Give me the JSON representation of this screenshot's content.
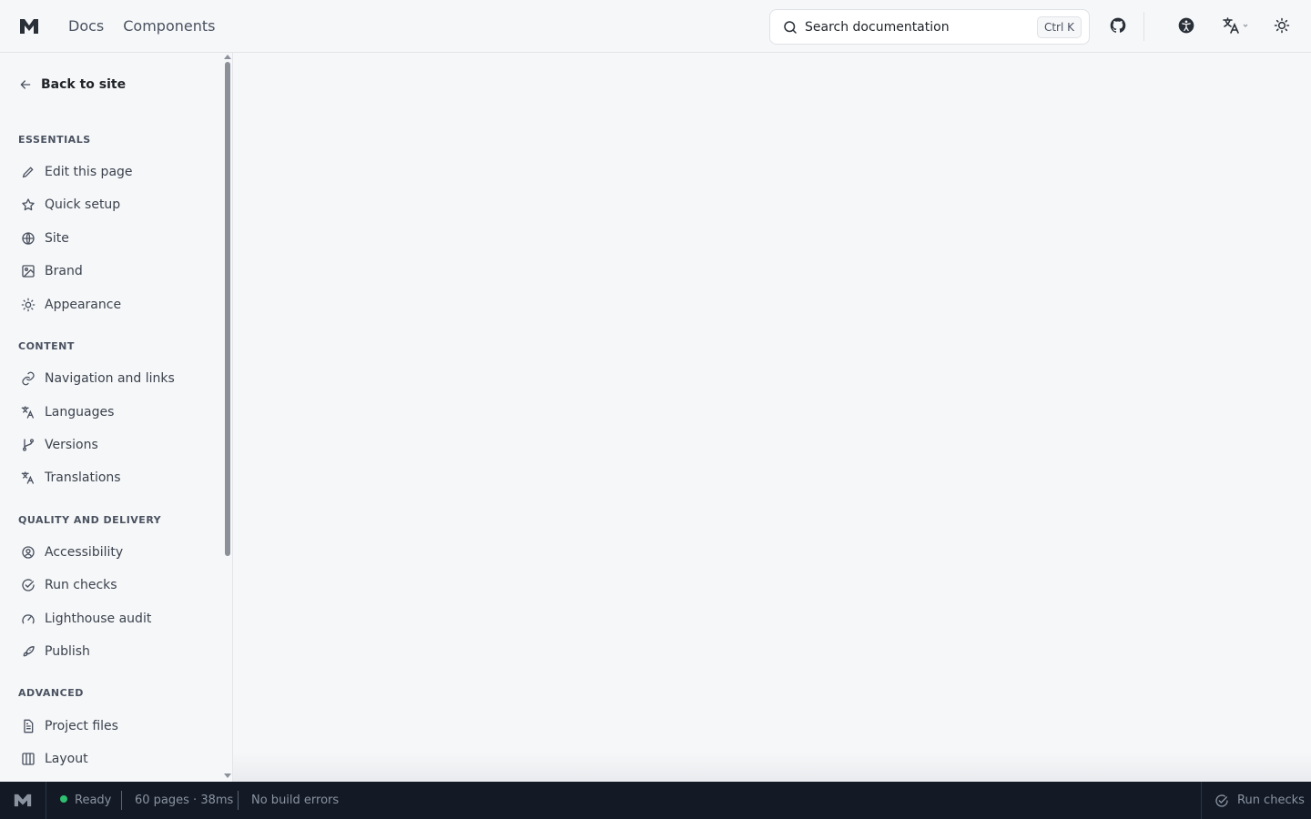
{
  "header": {
    "logo_icon": "brand-m-logo",
    "nav": [
      {
        "label": "Docs"
      },
      {
        "label": "Components"
      }
    ],
    "search": {
      "placeholder": "Search documentation",
      "shortcut": "Ctrl K"
    },
    "icons": [
      "github-icon",
      "accessibility-icon",
      "translate-icon",
      "theme-sun-icon"
    ]
  },
  "sidebar": {
    "back_label": "Back to site",
    "sections": [
      {
        "title": "ESSENTIALS",
        "items": [
          {
            "label": "Edit this page",
            "icon": "pencil-icon"
          },
          {
            "label": "Quick setup",
            "icon": "star-icon"
          },
          {
            "label": "Site",
            "icon": "globe-icon"
          },
          {
            "label": "Brand",
            "icon": "image-icon"
          },
          {
            "label": "Appearance",
            "icon": "sun-icon"
          }
        ]
      },
      {
        "title": "CONTENT",
        "items": [
          {
            "label": "Navigation and links",
            "icon": "link-icon"
          },
          {
            "label": "Languages",
            "icon": "translate-icon"
          },
          {
            "label": "Versions",
            "icon": "git-branch-icon"
          },
          {
            "label": "Translations",
            "icon": "translate-icon"
          }
        ]
      },
      {
        "title": "QUALITY AND DELIVERY",
        "items": [
          {
            "label": "Accessibility",
            "icon": "person-circle-icon"
          },
          {
            "label": "Run checks",
            "icon": "check-circle-icon"
          },
          {
            "label": "Lighthouse audit",
            "icon": "gauge-icon"
          },
          {
            "label": "Publish",
            "icon": "rocket-icon"
          }
        ]
      },
      {
        "title": "ADVANCED",
        "items": [
          {
            "label": "Project files",
            "icon": "file-icon"
          },
          {
            "label": "Layout",
            "icon": "columns-icon"
          }
        ]
      }
    ]
  },
  "statusbar": {
    "status": "Ready",
    "status_color": "#2fbf6e",
    "pages": "60 pages · 38ms",
    "build": "No build errors",
    "run_checks": "Run checks"
  }
}
